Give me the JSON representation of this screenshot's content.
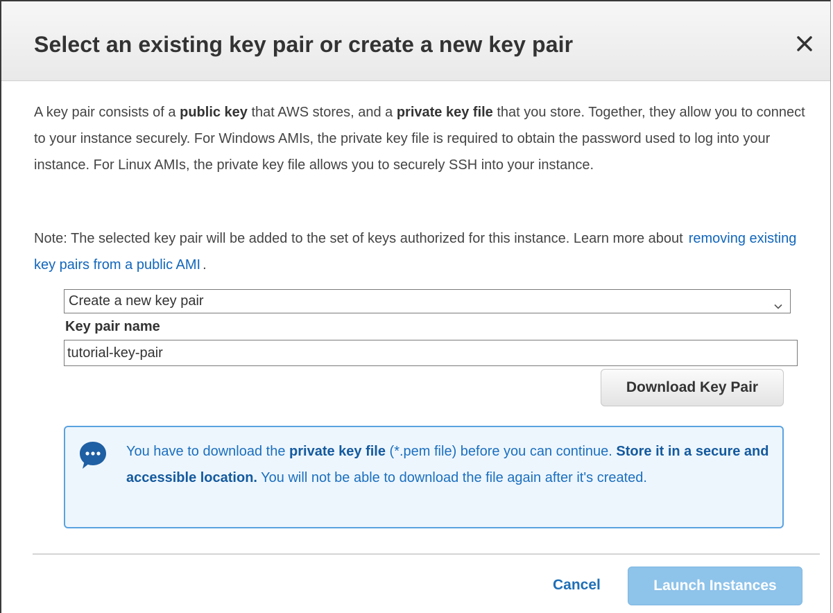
{
  "dialog": {
    "title": "Select an existing key pair or create a new key pair",
    "close_icon": "close-icon"
  },
  "description": {
    "p1_part1": "A key pair consists of a ",
    "p1_bold1": "public key",
    "p1_part2": " that AWS stores, and a ",
    "p1_bold2": "private key file",
    "p1_part3": " that you store. Together, they allow you to connect to your instance securely. For Windows AMIs, the private key file is required to obtain the password used to log into your instance. For Linux AMIs, the private key file allows you to securely SSH into your instance."
  },
  "note": {
    "text": "Note: The selected key pair will be added to the set of keys authorized for this instance. Learn more about",
    "link_text": "removing existing key pairs from a public AMI",
    "suffix": "."
  },
  "key_pair_select": {
    "selected": "Create a new key pair"
  },
  "key_pair_name": {
    "label": "Key pair name",
    "value": "tutorial-key-pair"
  },
  "download_button": {
    "label": "Download Key Pair"
  },
  "info_box": {
    "icon": "chat-bubble-icon",
    "part1": "You have to download the ",
    "bold1": "private key file",
    "part2": " (*.pem file) before you can continue. ",
    "bold2": "Store it in a secure and accessible location.",
    "part3": " You will not be able to download the file again after it's created."
  },
  "footer": {
    "cancel_label": "Cancel",
    "launch_label": "Launch Instances"
  },
  "colors": {
    "link": "#1166bb",
    "info_border": "#5aa2e0",
    "info_background": "#eef6fd",
    "launch_disabled": "#8ec3ea"
  }
}
